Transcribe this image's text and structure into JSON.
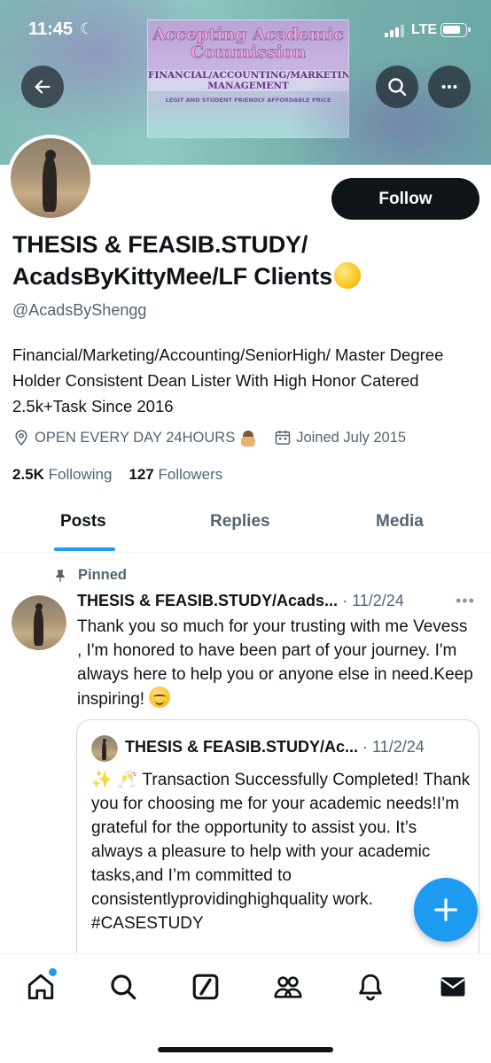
{
  "status_bar": {
    "time": "11:45",
    "moon": "☾",
    "network": "LTE"
  },
  "banner": {
    "title": "Accepting Academic Commission",
    "subtitle": "FINANCIAL/ACCOUNTING/MARKETING MANAGEMENT",
    "small": "LEGIT AND STUDENT FRIENDLY AFFORDABLE PRICE"
  },
  "header_actions": {
    "back": "back-arrow-icon",
    "search": "search-icon",
    "more": "more-icon"
  },
  "profile": {
    "follow_label": "Follow",
    "display_name": "THESIS & FEASIB.STUDY/ AcadsByKittyMee/LF Clients",
    "handle": "@AcadsByShengg",
    "bio": "Financial/Marketing/Accounting/SeniorHigh/ Master Degree Holder Consistent Dean Lister With High Honor Catered 2.5k+Task Since 2016",
    "location": "OPEN EVERY DAY 24HOURS",
    "joined": "Joined July 2015",
    "following_count": "2.5K",
    "following_label": "Following",
    "followers_count": "127",
    "followers_label": "Followers"
  },
  "tabs": [
    {
      "label": "Posts",
      "active": true
    },
    {
      "label": "Replies",
      "active": false
    },
    {
      "label": "Media",
      "active": false
    }
  ],
  "pinned_post": {
    "pinned_label": "Pinned",
    "author": "THESIS & FEASIB.STUDY/Acads...",
    "separator": " · ",
    "date": "11/2/24",
    "more": "•••",
    "text": "Thank you so much for your trusting with me Vevess , I'm honored to have been part of your journey. I'm always here to help you or anyone else in need.Keep inspiring!",
    "quote": {
      "author": "THESIS & FEASIB.STUDY/Ac...",
      "separator": " · ",
      "date": "11/2/24",
      "emojis": "✨ 🥂",
      "text": "Transaction Successfully Completed! Thank you for choosing me for your academic needs!I’m grateful for the opportunity to assist you. It’s always a pleasure to help with your academic tasks,and I’m committed to consistentlyprovidinghighquality work. #CASESTUDY"
    }
  },
  "fab_icon": "compose-plus-icon",
  "bottom_nav": [
    {
      "name": "home-icon",
      "notification_dot": true
    },
    {
      "name": "explore-search-icon"
    },
    {
      "name": "grok-icon"
    },
    {
      "name": "communities-icon"
    },
    {
      "name": "notifications-bell-icon"
    },
    {
      "name": "messages-envelope-icon"
    }
  ],
  "colors": {
    "accent": "#1d9bf0",
    "text": "#0f1419",
    "secondary": "#536471"
  }
}
